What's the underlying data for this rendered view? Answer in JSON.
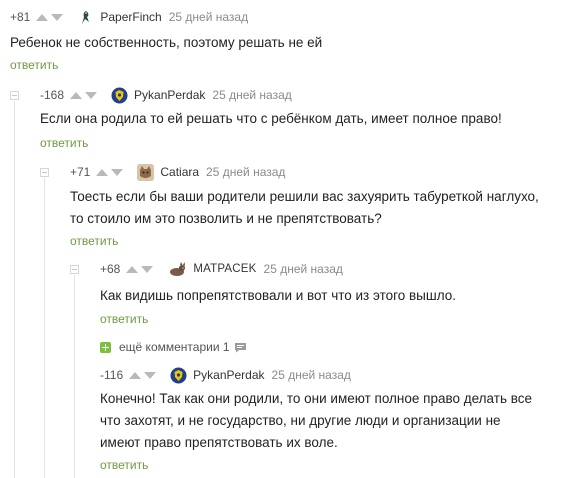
{
  "comments": [
    {
      "rating": "+81",
      "username": "PaperFinch",
      "time": "25 дней назад",
      "lines": [
        "Ребенок не собственность, поэтому решать не ей"
      ],
      "reply": "ответить",
      "avatar_icon": "paperfinch-bird-avatar"
    },
    {
      "rating": "-168",
      "username": "PykanPerdak",
      "time": "25 дней назад",
      "lines": [
        "Если она родила то ей решать что с ребёнком дать, имеет полное право!"
      ],
      "reply": "ответить",
      "avatar_icon": "shield-badge-avatar"
    },
    {
      "rating": "+71",
      "username": "Catiara",
      "time": "25 дней назад",
      "lines": [
        "Тоесть если бы ваши родители решили вас захуярить табуреткой наглухо,",
        "то стоило им это позволить и не препятствовать?"
      ],
      "reply": "ответить",
      "avatar_icon": "cat-photo-avatar"
    },
    {
      "rating": "+68",
      "username": "MATPACEK",
      "time": "25 дней назад",
      "lines": [
        "Как видишь попрепятствовали и вот что из этого вышло."
      ],
      "reply": "ответить",
      "avatar_icon": "animal-avatar"
    },
    {
      "rating": "-116",
      "username": "PykanPerdak",
      "time": "25 дней назад",
      "lines": [
        "Конечно! Так как они родили, то они имеют полное право делать все",
        "что захотят, и не государство, ни другие люди и организации не",
        "имеют право препятствовать их воле."
      ],
      "reply": "ответить",
      "avatar_icon": "shield-badge-avatar"
    }
  ],
  "more_comments": {
    "label": "ещё комментарии 1"
  },
  "colors": {
    "reply_link": "#6d9b3f",
    "arrow": "#b9b9b9",
    "plus_box": "#7fbf3f",
    "thread_line": "#e4e4e4"
  }
}
